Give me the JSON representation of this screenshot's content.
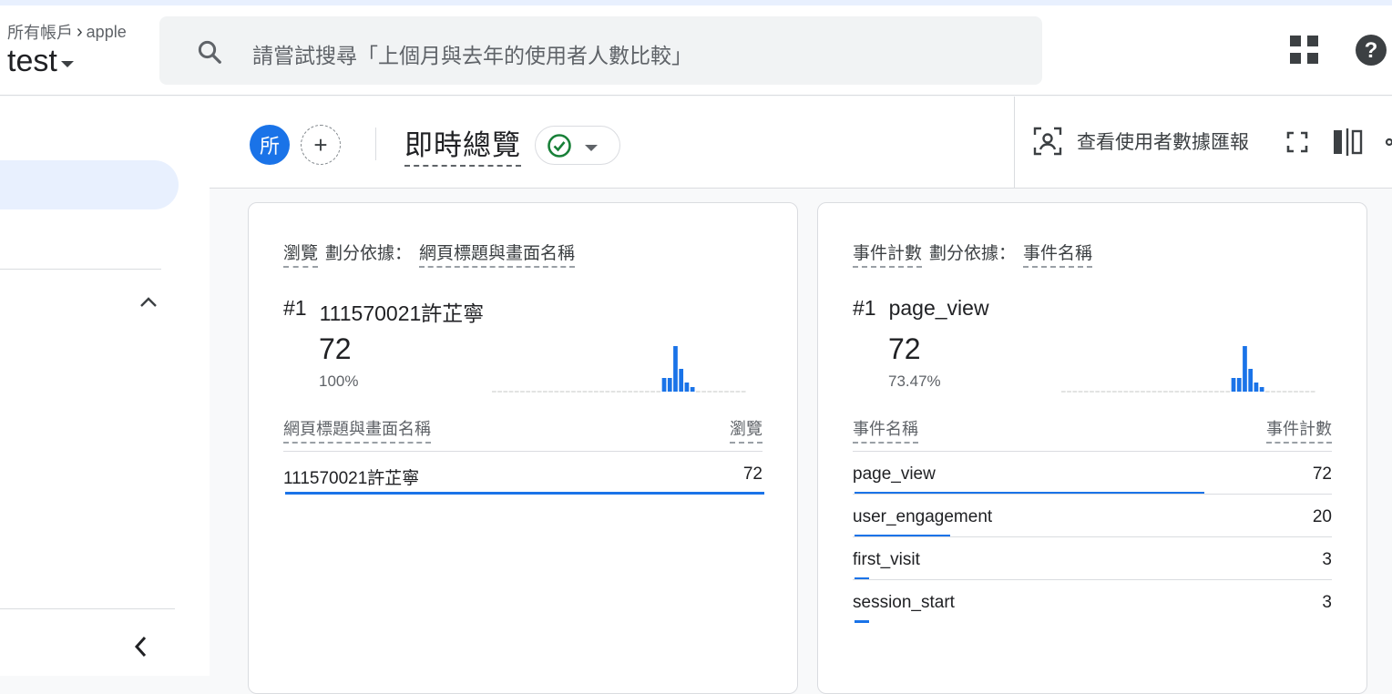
{
  "header": {
    "breadcrumb_all": "所有帳戶",
    "breadcrumb_account": "apple",
    "property_name": "test",
    "search_placeholder": "請嘗試搜尋「上個月與去年的使用者人數比較」"
  },
  "toolbar": {
    "comparison_chip": "所",
    "add_comparison": "+",
    "page_title": "即時總覽",
    "user_snapshot_label": "查看使用者數據匯報"
  },
  "cards": [
    {
      "metric": "瀏覽",
      "breakdown_label": "劃分依據：",
      "dimension": "網頁標題與畫面名稱",
      "top_rank": "#1",
      "top_name": "111570021許芷寧",
      "top_value": "72",
      "top_percent": "100%",
      "sparkline": [
        0,
        0,
        0,
        0,
        0,
        0,
        0,
        0,
        0,
        0,
        0,
        0,
        0,
        0,
        0,
        0,
        0,
        0,
        0,
        0,
        0,
        0,
        0,
        0,
        0,
        0,
        0,
        0,
        0,
        0,
        3,
        3,
        10,
        5,
        2,
        1,
        0,
        0,
        0,
        0,
        0,
        0,
        0,
        0,
        0
      ],
      "col_dimension": "網頁標題與畫面名稱",
      "col_metric": "瀏覽",
      "rows": [
        {
          "name": "111570021許芷寧",
          "value": "72",
          "ratio": 1.0
        }
      ]
    },
    {
      "metric": "事件計數",
      "breakdown_label": "劃分依據：",
      "dimension": "事件名稱",
      "top_rank": "#1",
      "top_name": "page_view",
      "top_value": "72",
      "top_percent": "73.47%",
      "sparkline": [
        0,
        0,
        0,
        0,
        0,
        0,
        0,
        0,
        0,
        0,
        0,
        0,
        0,
        0,
        0,
        0,
        0,
        0,
        0,
        0,
        0,
        0,
        0,
        0,
        0,
        0,
        0,
        0,
        0,
        0,
        3,
        3,
        10,
        5,
        2,
        1,
        0,
        0,
        0,
        0,
        0,
        0,
        0,
        0,
        0
      ],
      "col_dimension": "事件名稱",
      "col_metric": "事件計數",
      "rows": [
        {
          "name": "page_view",
          "value": "72",
          "ratio": 0.73
        },
        {
          "name": "user_engagement",
          "value": "20",
          "ratio": 0.2
        },
        {
          "name": "first_visit",
          "value": "3",
          "ratio": 0.03
        },
        {
          "name": "session_start",
          "value": "3",
          "ratio": 0.03
        }
      ]
    }
  ],
  "colors": {
    "accent": "#1a73e8",
    "success": "#188038"
  }
}
